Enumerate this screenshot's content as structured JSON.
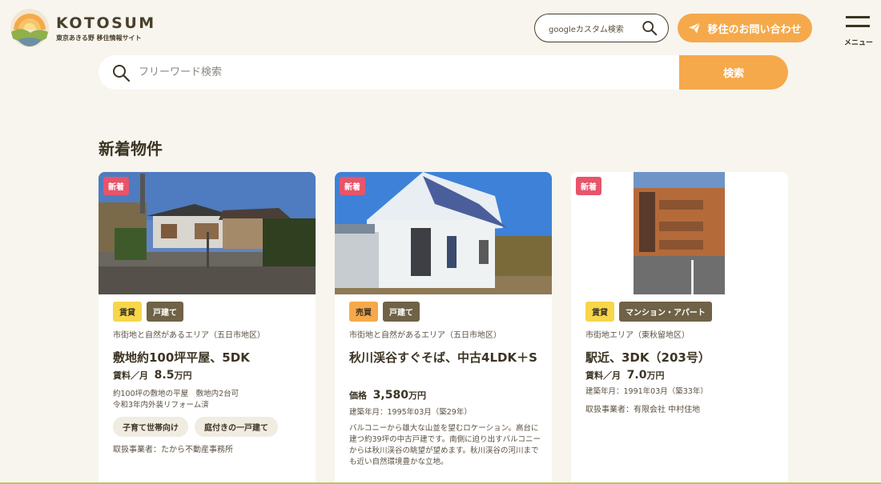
{
  "header": {
    "logo_title": "KOTOSUM",
    "logo_sub": "東京あきる野 移住情報サイト",
    "google_search_label": "googleカスタム検索",
    "contact_label": "移住のお問い合わせ",
    "menu_label": "メニュー"
  },
  "search": {
    "placeholder": "フリーワード検索",
    "submit_label": "検索"
  },
  "section_title": "新着物件",
  "colors": {
    "accent": "#f5a94b",
    "new_badge": "#e8546a",
    "rent_tag": "#f7d64a",
    "type_tag": "#6f6246"
  },
  "cards": [
    {
      "badge": "新着",
      "tag_deal": "賃貸",
      "tag_type": "戸建て",
      "area": "市街地と自然があるエリア（五日市地区）",
      "title": "敷地約100坪平屋、5DK",
      "price_label": "賃料／月",
      "price_value": "8.5",
      "price_unit": "万円",
      "desc1": "約100坪の敷地の平屋　敷地内2台可",
      "desc2": "令和3年内外装リフォーム済",
      "chip1": "子育て世帯向け",
      "chip2": "庭付きの一戸建て",
      "dealer": "取扱事業者：たから不動産事務所"
    },
    {
      "badge": "新着",
      "tag_deal": "売買",
      "tag_type": "戸建て",
      "area": "市街地と自然があるエリア（五日市地区）",
      "title": "秋川渓谷すぐそば、中古4LDK＋S",
      "price_label": "価格",
      "price_value": "3,580",
      "price_unit": "万円",
      "built": "建築年月：1995年03月（築29年）",
      "desc": "バルコニーから雄大な山並を望むロケーション。高台に建つ約39坪の中古戸建です。南側に迫り出すバルコニーからは秋川渓谷の眺望が望めます。秋川渓谷の河川までも近い自然環境豊かな立地。"
    },
    {
      "badge": "新着",
      "tag_deal": "賃貸",
      "tag_type": "マンション・アパート",
      "area": "市街地エリア（東秋留地区）",
      "title": "駅近、3DK（203号）",
      "price_label": "賃料／月",
      "price_value": "7.0",
      "price_unit": "万円",
      "built": "建築年月：1991年03月（築33年）",
      "dealer": "取扱事業者：有限会社 中村住地"
    }
  ]
}
